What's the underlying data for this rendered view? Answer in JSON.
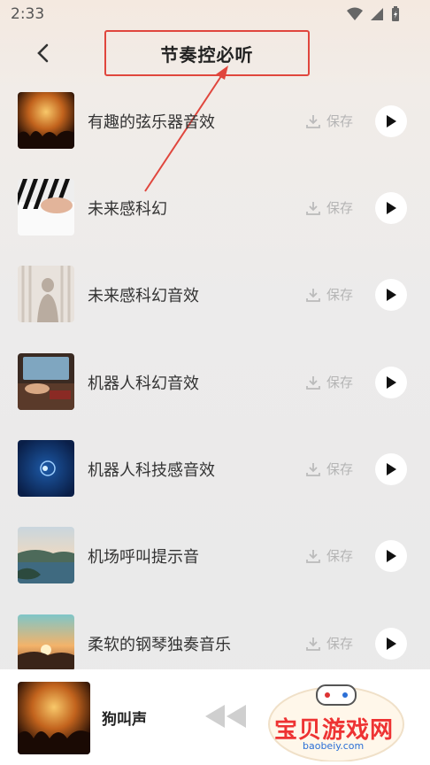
{
  "status_bar": {
    "time": "2:33"
  },
  "header": {
    "title": "节奏控必听"
  },
  "save_label": "保存",
  "songs": [
    {
      "title": "有趣的弦乐器音效"
    },
    {
      "title": "未来感科幻"
    },
    {
      "title": "未来感科幻音效"
    },
    {
      "title": "机器人科幻音效"
    },
    {
      "title": "机器人科技感音效"
    },
    {
      "title": "机场呼叫提示音"
    },
    {
      "title": "柔软的钢琴独奏音乐"
    }
  ],
  "player": {
    "title": "狗叫声"
  },
  "watermark": {
    "text": "宝贝游戏网",
    "domain": "baobeiy.com"
  },
  "colors": {
    "annotation": "#e0463d",
    "accent": "#222222"
  }
}
